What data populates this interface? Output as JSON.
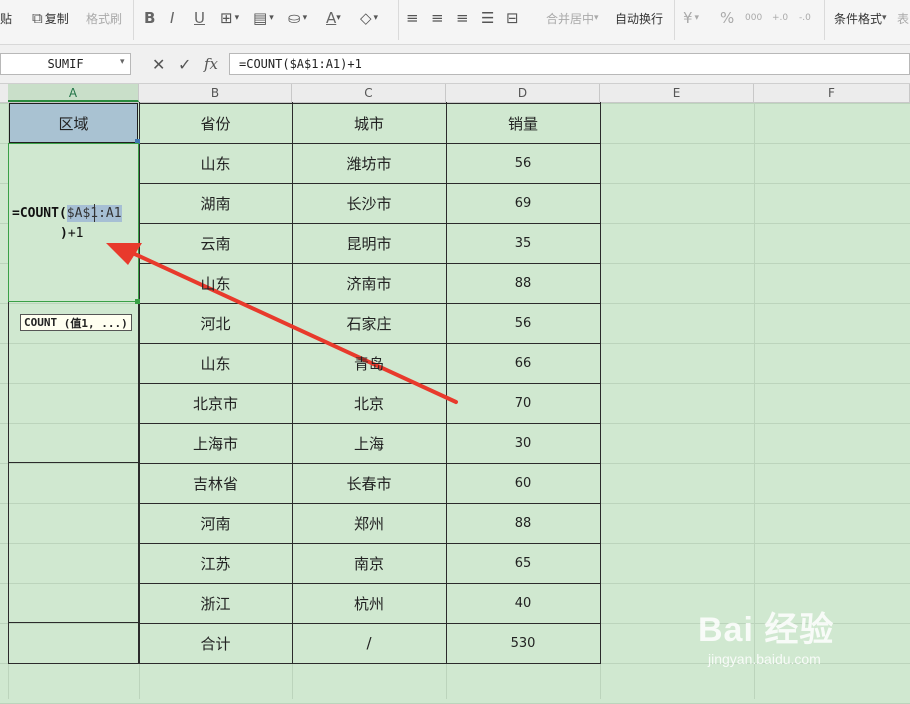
{
  "ribbon": {
    "paste_label": "贴",
    "copy_label": "复制",
    "format_painter_label": "格式刷",
    "merge_center_label": "合并居中",
    "wrap_text_label": "自动换行",
    "cond_format_label": "条件格式",
    "table_style_label": "表",
    "bold": "B",
    "italic": "I",
    "underline": "U",
    "font_color": "A",
    "percent": "%",
    "thousands": "000",
    "dec_inc": "+.0",
    "dec_dec": "-.0"
  },
  "formula_bar": {
    "name_box": "SUMIF",
    "cancel_icon": "✕",
    "confirm_icon": "✓",
    "fx_icon": "fx",
    "formula": "=COUNT($A$1:A1)+1"
  },
  "columns": [
    "A",
    "B",
    "C",
    "D",
    "E",
    "F"
  ],
  "table": {
    "a1": "区域",
    "headers": [
      "省份",
      "城市",
      "销量"
    ],
    "rows": [
      [
        "山东",
        "潍坊市",
        "56"
      ],
      [
        "湖南",
        "长沙市",
        "69"
      ],
      [
        "云南",
        "昆明市",
        "35"
      ],
      [
        "山东",
        "济南市",
        "88"
      ],
      [
        "河北",
        "石家庄",
        "56"
      ],
      [
        "山东",
        "青岛",
        "66"
      ],
      [
        "北京市",
        "北京",
        "70"
      ],
      [
        "上海市",
        "上海",
        "30"
      ],
      [
        "吉林省",
        "长春市",
        "60"
      ],
      [
        "河南",
        "郑州",
        "88"
      ],
      [
        "江苏",
        "南京",
        "65"
      ],
      [
        "浙江",
        "杭州",
        "40"
      ],
      [
        "合计",
        "/",
        "530"
      ]
    ]
  },
  "editing": {
    "prefix": "=COUNT(",
    "ref": "$A$1:A1",
    "close": ")",
    "suffix": "+1",
    "tooltip_fn": "COUNT",
    "tooltip_args": "(值1, ...)"
  },
  "colors": {
    "sheet_bg": "#d0e8d0",
    "selected_cell": "#a9c2d2",
    "edit_border": "#3aa047",
    "arrow": "#e83a2c"
  },
  "watermark": {
    "main": "Bai 经验",
    "sub": "jingyan.baidu.com"
  }
}
